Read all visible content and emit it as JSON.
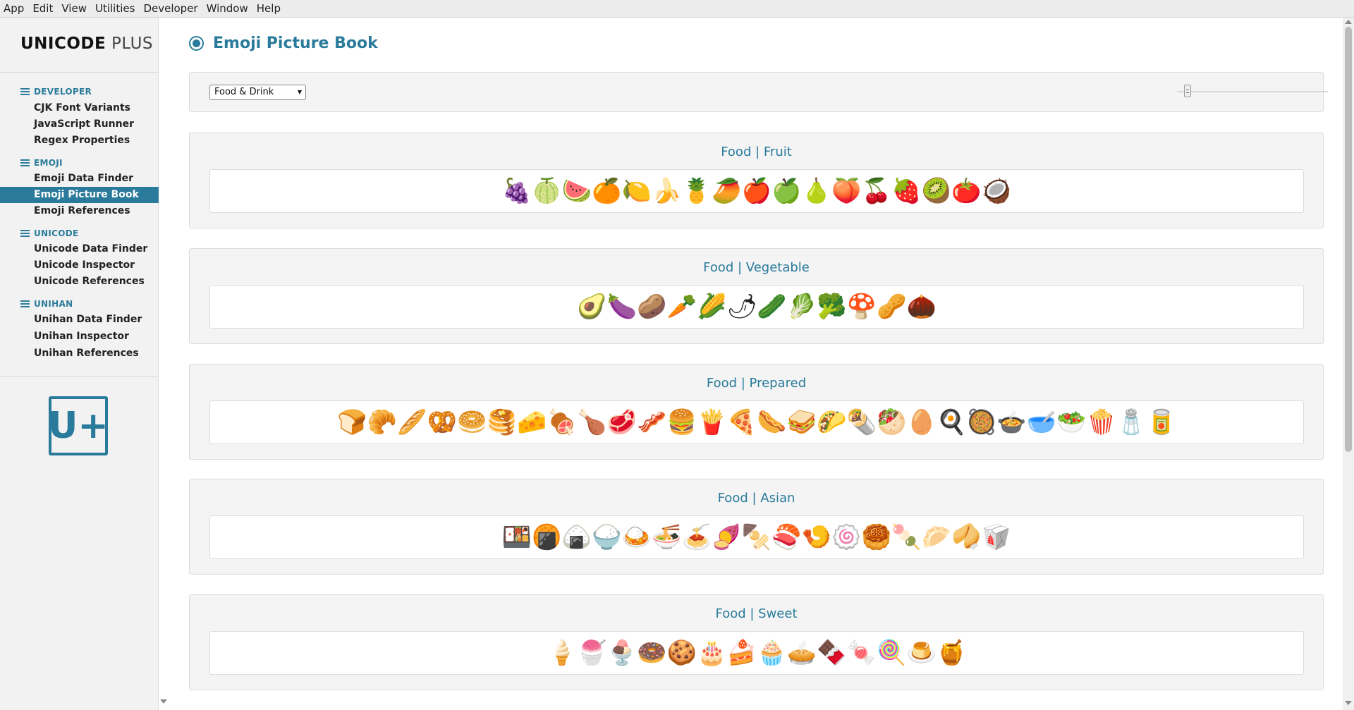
{
  "menu": [
    "App",
    "Edit",
    "View",
    "Utilities",
    "Developer",
    "Window",
    "Help"
  ],
  "brand": {
    "bold": "UNICODE",
    "light": "PLUS"
  },
  "logo": "U+",
  "sidebar": {
    "sections": [
      {
        "title": "DEVELOPER",
        "items": [
          "CJK Font Variants",
          "JavaScript Runner",
          "Regex Properties"
        ]
      },
      {
        "title": "EMOJI",
        "items": [
          "Emoji Data Finder",
          "Emoji Picture Book",
          "Emoji References"
        ]
      },
      {
        "title": "UNICODE",
        "items": [
          "Unicode Data Finder",
          "Unicode Inspector",
          "Unicode References"
        ]
      },
      {
        "title": "UNIHAN",
        "items": [
          "Unihan Data Finder",
          "Unihan Inspector",
          "Unihan References"
        ]
      }
    ],
    "active": "Emoji Picture Book"
  },
  "page": {
    "title": "Emoji Picture Book"
  },
  "toolbar": {
    "category_selected": "Food & Drink",
    "size_slider_level": 0.05
  },
  "colors": {
    "accent": "#2a7b9b",
    "panel": "#f4f4f4",
    "border": "#dcdcdc"
  },
  "groups": [
    {
      "title": "Food | Fruit",
      "emojis": [
        "🍇",
        "🍈",
        "🍉",
        "🍊",
        "🍋",
        "🍌",
        "🍍",
        "🥭",
        "🍎",
        "🍏",
        "🍐",
        "🍑",
        "🍒",
        "🍓",
        "🥝",
        "🍅",
        "🥥"
      ]
    },
    {
      "title": "Food | Vegetable",
      "emojis": [
        "🥑",
        "🍆",
        "🥔",
        "🥕",
        "🌽",
        "🌶",
        "🥒",
        "🥬",
        "🥦",
        "🍄",
        "🥜",
        "🌰"
      ]
    },
    {
      "title": "Food | Prepared",
      "emojis": [
        "🍞",
        "🥐",
        "🥖",
        "🥨",
        "🥯",
        "🥞",
        "🧀",
        "🍖",
        "🍗",
        "🥩",
        "🥓",
        "🍔",
        "🍟",
        "🍕",
        "🌭",
        "🥪",
        "🌮",
        "🌯",
        "🥙",
        "🥚",
        "🍳",
        "🥘",
        "🍲",
        "🥣",
        "🥗",
        "🍿",
        "🧂",
        "🥫"
      ]
    },
    {
      "title": "Food | Asian",
      "emojis": [
        "🍱",
        "🍘",
        "🍙",
        "🍚",
        "🍛",
        "🍜",
        "🍝",
        "🍠",
        "🍢",
        "🍣",
        "🍤",
        "🍥",
        "🥮",
        "🍡",
        "🥟",
        "🥠",
        "🥡"
      ]
    },
    {
      "title": "Food | Sweet",
      "emojis": [
        "🍦",
        "🍧",
        "🍨",
        "🍩",
        "🍪",
        "🎂",
        "🍰",
        "🧁",
        "🥧",
        "🍫",
        "🍬",
        "🍭",
        "🍮",
        "🍯"
      ]
    }
  ]
}
